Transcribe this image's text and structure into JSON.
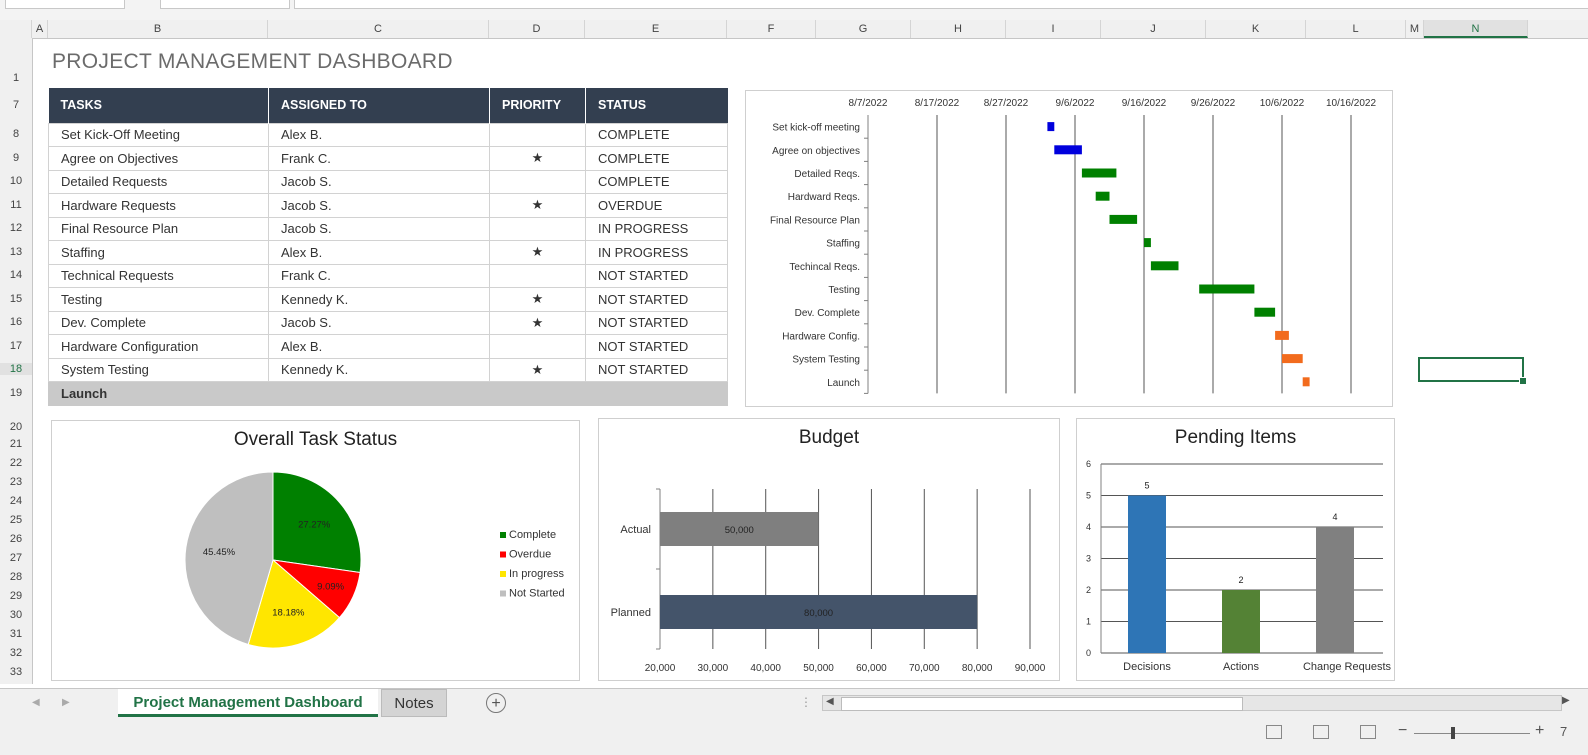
{
  "columns": [
    "A",
    "B",
    "C",
    "D",
    "E",
    "F",
    "G",
    "H",
    "I",
    "J",
    "K",
    "L",
    "M",
    "N"
  ],
  "rows": [
    "1",
    "7",
    "8",
    "9",
    "10",
    "11",
    "12",
    "13",
    "14",
    "15",
    "16",
    "17",
    "18",
    "19",
    "20",
    "21",
    "22",
    "23",
    "24",
    "25",
    "26",
    "27",
    "28",
    "29",
    "30",
    "31",
    "32",
    "33"
  ],
  "dashboard_title": "PROJECT MANAGEMENT DASHBOARD",
  "table": {
    "headers": [
      "TASKS",
      "ASSIGNED TO",
      "PRIORITY",
      "STATUS"
    ],
    "rows": [
      {
        "task": "Set Kick-Off Meeting",
        "assigned": "Alex B.",
        "priority": "",
        "status": "COMPLETE",
        "status_class": "complete"
      },
      {
        "task": "Agree on Objectives",
        "assigned": "Frank C.",
        "priority": "★",
        "status": "COMPLETE",
        "status_class": "complete"
      },
      {
        "task": "Detailed Requests",
        "assigned": "Jacob S.",
        "priority": "",
        "status": "COMPLETE",
        "status_class": "complete"
      },
      {
        "task": "Hardware Requests",
        "assigned": "Jacob S.",
        "priority": "★",
        "status": "OVERDUE",
        "status_class": "overdue"
      },
      {
        "task": "Final Resource Plan",
        "assigned": "Jacob S.",
        "priority": "",
        "status": "IN PROGRESS",
        "status_class": "progress"
      },
      {
        "task": "Staffing",
        "assigned": "Alex B.",
        "priority": "★",
        "status": "IN PROGRESS",
        "status_class": "progress"
      },
      {
        "task": "Technical Requests",
        "assigned": "Frank C.",
        "priority": "",
        "status": "NOT STARTED",
        "status_class": "notstarted"
      },
      {
        "task": "Testing",
        "assigned": "Kennedy K.",
        "priority": "★",
        "status": "NOT STARTED",
        "status_class": "notstarted"
      },
      {
        "task": "Dev. Complete",
        "assigned": "Jacob S.",
        "priority": "★",
        "status": "NOT STARTED",
        "status_class": "notstarted"
      },
      {
        "task": "Hardware Configuration",
        "assigned": "Alex B.",
        "priority": "",
        "status": "NOT STARTED",
        "status_class": "notstarted"
      },
      {
        "task": "System Testing",
        "assigned": "Kennedy K.",
        "priority": "★",
        "status": "NOT STARTED",
        "status_class": "notstarted"
      }
    ],
    "last_row": "Launch"
  },
  "colors": {
    "header_bg": "#333f50",
    "complete": "#008000",
    "overdue": "#ff0000",
    "in_progress": "#ffe600",
    "not_started": "#bfbfbf",
    "accent": "#217346",
    "gantt_blue": "#0000dd",
    "gantt_green": "#008000",
    "gantt_orange": "#f26b1d"
  },
  "chart_data": [
    {
      "type": "gantt",
      "x_ticks": [
        "8/7/2022",
        "8/17/2022",
        "8/27/2022",
        "9/6/2022",
        "9/16/2022",
        "9/26/2022",
        "10/6/2022",
        "10/16/2022"
      ],
      "tasks": [
        {
          "label": "Set kick-off meeting",
          "start": "9/2/2022",
          "end": "9/3/2022",
          "color": "blue"
        },
        {
          "label": "Agree on objectives",
          "start": "9/3/2022",
          "end": "9/7/2022",
          "color": "blue"
        },
        {
          "label": "Detailed Reqs.",
          "start": "9/7/2022",
          "end": "9/12/2022",
          "color": "green"
        },
        {
          "label": "Hardward Reqs.",
          "start": "9/9/2022",
          "end": "9/11/2022",
          "color": "green"
        },
        {
          "label": "Final Resource Plan",
          "start": "9/11/2022",
          "end": "9/15/2022",
          "color": "green"
        },
        {
          "label": "Staffing",
          "start": "9/16/2022",
          "end": "9/17/2022",
          "color": "green"
        },
        {
          "label": "Techincal Reqs.",
          "start": "9/17/2022",
          "end": "9/21/2022",
          "color": "green"
        },
        {
          "label": "Testing",
          "start": "9/24/2022",
          "end": "10/2/2022",
          "color": "green"
        },
        {
          "label": "Dev. Complete",
          "start": "10/2/2022",
          "end": "10/5/2022",
          "color": "green"
        },
        {
          "label": "Hardware Config.",
          "start": "10/5/2022",
          "end": "10/7/2022",
          "color": "orange"
        },
        {
          "label": "System Testing",
          "start": "10/6/2022",
          "end": "10/9/2022",
          "color": "orange"
        },
        {
          "label": "Launch",
          "start": "10/9/2022",
          "end": "10/10/2022",
          "color": "orange"
        }
      ]
    },
    {
      "type": "pie",
      "title": "Overall Task Status",
      "slices": [
        {
          "name": "Complete",
          "value": 27.27,
          "label": "27.27%"
        },
        {
          "name": "Overdue",
          "value": 9.09,
          "label": "9.09%"
        },
        {
          "name": "In progress",
          "value": 18.18,
          "label": "18.18%"
        },
        {
          "name": "Not Started",
          "value": 45.45,
          "label": "45.45%"
        }
      ],
      "legend_position": "right"
    },
    {
      "type": "bar",
      "orientation": "horizontal",
      "title": "Budget",
      "categories": [
        "Actual",
        "Planned"
      ],
      "values": [
        50000,
        80000
      ],
      "data_labels": [
        "50,000",
        "80,000"
      ],
      "x_ticks": [
        "20,000",
        "30,000",
        "40,000",
        "50,000",
        "60,000",
        "70,000",
        "80,000",
        "90,000"
      ],
      "xlim": [
        20000,
        90000
      ],
      "bar_colors": [
        "#7f7f7f",
        "#44546a"
      ]
    },
    {
      "type": "bar",
      "title": "Pending Items",
      "categories": [
        "Decisions",
        "Actions",
        "Change Requests"
      ],
      "values": [
        5,
        2,
        4
      ],
      "data_labels": [
        "5",
        "2",
        "4"
      ],
      "ylim": [
        0,
        6
      ],
      "y_ticks": [
        "0",
        "1",
        "2",
        "3",
        "4",
        "5",
        "6"
      ],
      "bar_colors": [
        "#2e75b6",
        "#548235",
        "#808080"
      ]
    }
  ],
  "sheet_tabs": {
    "active": "Project Management Dashboard",
    "other": "Notes",
    "add": "+"
  },
  "status_bar": {
    "zoom_minus": "−",
    "zoom_plus": "+",
    "zoom_partial": "7"
  }
}
